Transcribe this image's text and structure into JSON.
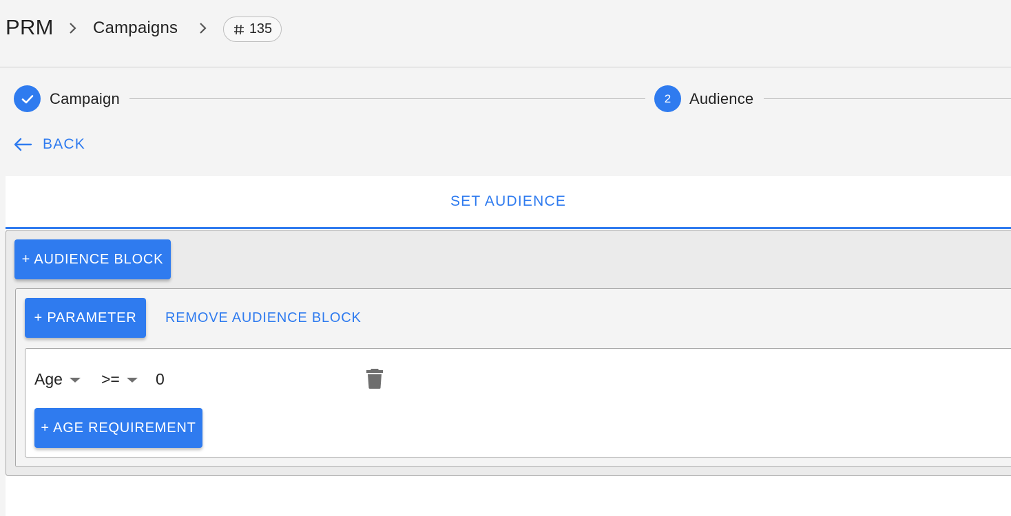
{
  "breadcrumb": {
    "root": "PRM",
    "section": "Campaigns",
    "id_label": "135"
  },
  "stepper": {
    "steps": [
      {
        "label": "Campaign",
        "state": "completed",
        "icon": "check-icon"
      },
      {
        "label": "Audience",
        "state": "active",
        "number": "2"
      }
    ]
  },
  "back_label": "BACK",
  "tab_label": "SET AUDIENCE",
  "audience_block_button": "+ AUDIENCE BLOCK",
  "block": {
    "add_parameter_button": "+ PARAMETER",
    "remove_block_button": "REMOVE AUDIENCE BLOCK",
    "parameter": {
      "field": "Age",
      "operator": ">=",
      "value": "0",
      "add_requirement_button": "+ AGE REQUIREMENT"
    }
  },
  "colors": {
    "accent": "#2f7bef",
    "background": "#f4f4f4",
    "card": "#ffffff"
  }
}
